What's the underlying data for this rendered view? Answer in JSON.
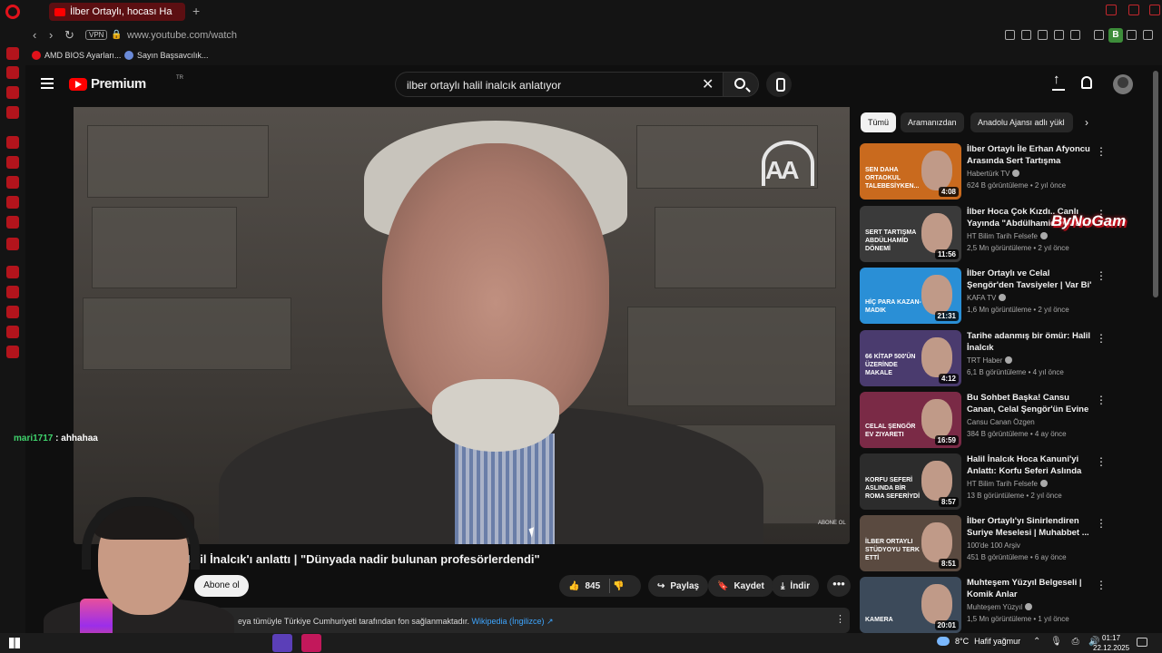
{
  "browser": {
    "tab_title": "İlber Ortaylı, hocası Ha",
    "url": "www.youtube.com/watch",
    "vpn_label": "VPN",
    "profile_initial": "B",
    "bookmarks": [
      {
        "label": "AMD BIOS Ayarları..."
      },
      {
        "label": "Sayın Başsavcılık..."
      }
    ]
  },
  "youtube": {
    "logo_text": "Premium",
    "logo_region": "TR",
    "search_query": "ilber ortaylı halil inalcık anlatıyor"
  },
  "video": {
    "channel_watermark": "AA",
    "corner_watermark": "ABONE OL",
    "title": "Halil İnalcık'ı anlattı | \"Dünyada nadir bulunan profesörlerdendi\"",
    "subscribe_label": "Abone ol",
    "like_count": "845",
    "share_label": "Paylaş",
    "save_label": "Kaydet",
    "download_label": "İndir",
    "more_label": "•••",
    "info_text": "eya tümüyle Türkiye Cumhuriyeti tarafından fon sağlanmaktadır.",
    "info_link": "Wikipedia (İngilizce) ↗",
    "info_menu": "⋮"
  },
  "stream_overlay": {
    "chat_user": "mari1717",
    "chat_text": ": ahhahaa",
    "sponsor_text": "ByNoGam"
  },
  "chips": [
    {
      "label": "Tümü",
      "active": true
    },
    {
      "label": "Aramanızdan",
      "active": false
    },
    {
      "label": "Anadolu Ajansı adlı yükl",
      "active": false
    }
  ],
  "chips_next": "›",
  "recommendations": [
    {
      "title": "İlber Ortaylı İle Erhan Afyoncu Arasında Sert Tartışma",
      "channel": "Habertürk TV",
      "views": "624 B görüntüleme",
      "age": "2 yıl önce",
      "duration": "4:08",
      "thumb_text": "SEN DAHA ORTAOKUL TALEBESİYKEN...",
      "thumb_color": "#c96a1e",
      "verified": true
    },
    {
      "title": "İlber Hoca Çok Kızdı.. Canlı Yayında \"Abdülhamid Dönemi\"",
      "channel": "HT Bilim Tarih Felsefe",
      "views": "2,5 Mn görüntüleme",
      "age": "2 yıl önce",
      "duration": "11:56",
      "thumb_text": "SERT TARTIŞMA ABDÜLHAMİD DÖNEMİ",
      "thumb_color": "#3a3a3a",
      "verified": true
    },
    {
      "title": "İlber Ortaylı ve Celal Şengör'den Tavsiyeler | Var Bi' Hayalim",
      "channel": "KAFA TV",
      "views": "1,6 Mn görüntüleme",
      "age": "2 yıl önce",
      "duration": "21:31",
      "thumb_text": "HİÇ PARA KAZAN-MADIK",
      "thumb_color": "#2a8fd6",
      "verified": true
    },
    {
      "title": "Tarihe adanmış bir ömür: Halil İnalcık",
      "channel": "TRT Haber",
      "views": "6,1 B görüntüleme",
      "age": "4 yıl önce",
      "duration": "4:12",
      "thumb_text": "66 KİTAP 500'ÜN ÜZERİNDE MAKALE",
      "thumb_color": "#4a3b6e",
      "verified": true
    },
    {
      "title": "Bu Sohbet Başka! Cansu Canan, Celal Şengör'ün Evine Konuk ...",
      "channel": "Cansu Canan Özgen",
      "views": "384 B görüntüleme",
      "age": "4 ay önce",
      "duration": "16:59",
      "thumb_text": "Celal Şengör Ev Ziyareti",
      "thumb_color": "#7a2a46",
      "verified": false
    },
    {
      "title": "Halil İnalcık Hoca Kanuni'yi Anlattı: Korfu Seferi Aslında Bi...",
      "channel": "HT Bilim Tarih Felsefe",
      "views": "13 B görüntüleme",
      "age": "2 yıl önce",
      "duration": "8:57",
      "thumb_text": "KORFU SEFERİ ASLINDA BİR ROMA SEFERİYDİ",
      "thumb_color": "#2c2c2c",
      "verified": true
    },
    {
      "title": "İlber Ortaylı'yı Sinirlendiren Suriye Meselesi | Muhabbet ...",
      "channel": "100'de 100 Arşiv",
      "views": "451 B görüntüleme",
      "age": "6 ay önce",
      "duration": "8:51",
      "thumb_text": "İLBER ORTAYLI STÜDYOYU TERK ETTİ",
      "thumb_color": "#5a4a40",
      "verified": false
    },
    {
      "title": "Muhteşem Yüzyıl Belgeseli | Komik Anlar",
      "channel": "Muhteşem Yüzyıl",
      "views": "1,5 Mn görüntüleme",
      "age": "1 yıl önce",
      "duration": "20:01",
      "thumb_text": "KAMERA",
      "thumb_color": "#3c4a5a",
      "verified": true
    }
  ],
  "taskbar": {
    "weather_temp": "8°C",
    "weather_text": "Hafif yağmur",
    "tray": "⌃ 🎙 ⎙ 🔊",
    "time": "01:17",
    "date": "22.12.2025"
  },
  "colors": {
    "youtube_red": "#ff0000",
    "opera_red": "#e0121b",
    "background": "#0f0f0f"
  }
}
